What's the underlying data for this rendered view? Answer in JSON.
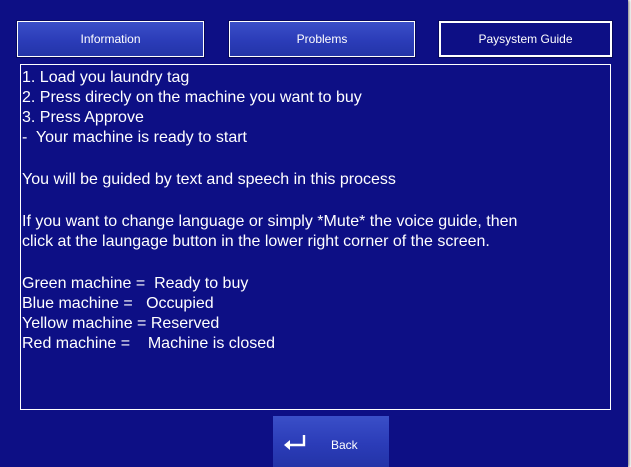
{
  "tabs": {
    "information": "Information",
    "problems": "Problems",
    "paysystem_guide": "Paysystem Guide"
  },
  "guide": {
    "steps": [
      "1. Load you laundry tag",
      "2. Press direcly on the machine you want to buy",
      "3. Press Approve",
      "-  Your machine is ready to start"
    ],
    "guided_note": "You will be guided by text and speech in this process",
    "language_note": [
      "If you want to change language or simply *Mute* the voice guide, then",
      "click at the laungage button in the lower right corner of the screen."
    ],
    "legend": [
      "Green machine =  Ready to buy",
      "Blue machine =   Occupied",
      "Yellow machine = Reserved",
      "Red machine =    Machine is closed"
    ]
  },
  "back_button": {
    "label": "Back",
    "icon": "return-arrow-icon"
  },
  "colors": {
    "background": "#0d0f85",
    "button": "#2b3cb8",
    "text": "#ffffff"
  }
}
